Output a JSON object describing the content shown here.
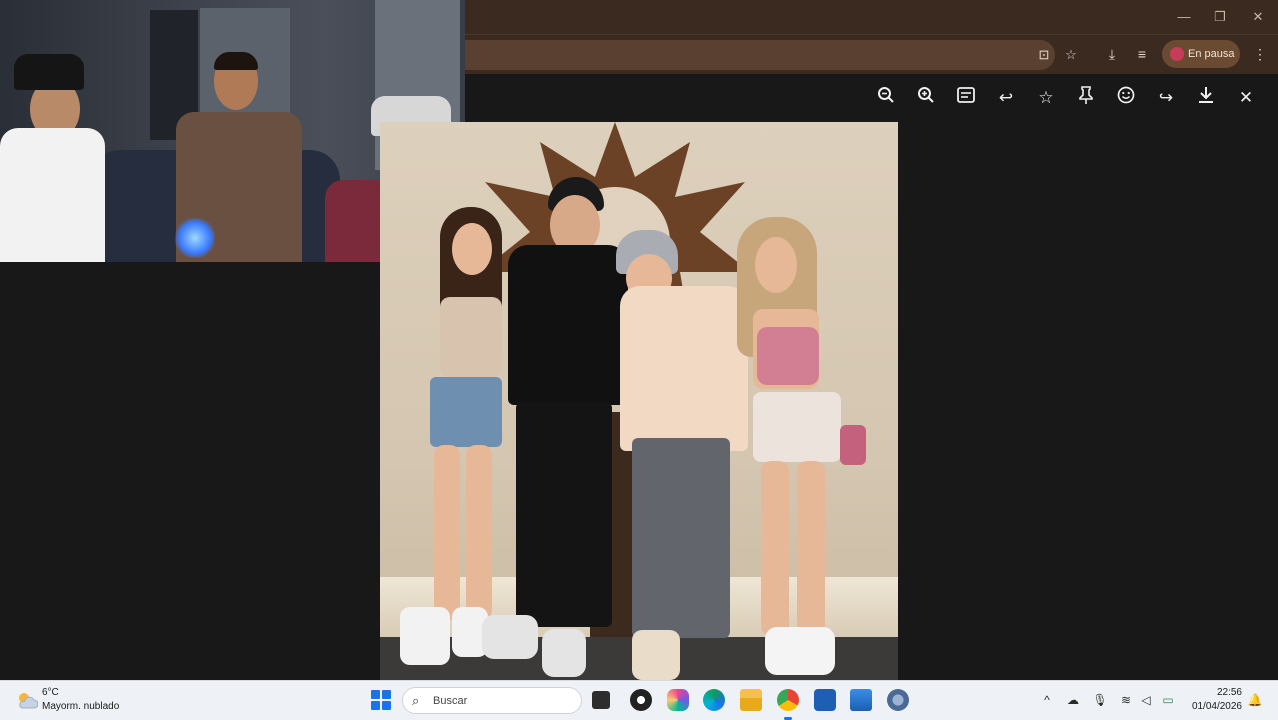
{
  "browser": {
    "window_controls": {
      "minimize": "—",
      "restore": "❐",
      "close": "✕"
    },
    "profile_status": "En pausa"
  },
  "viewer_toolbar": {
    "icons": [
      "zoom-out-icon",
      "zoom-in-icon",
      "caption-icon",
      "reply-icon",
      "star-icon",
      "pin-icon",
      "emoji-icon",
      "forward-icon",
      "download-icon",
      "close-icon"
    ]
  },
  "taskbar": {
    "weather": {
      "temp": "6°C",
      "desc": "Mayorm. nublado"
    },
    "search_placeholder": "Buscar",
    "clock": {
      "time": "22:56",
      "date": "01/04/2026"
    }
  },
  "colors": {
    "browser_frame": "#3a2a1f",
    "viewer_bg": "#181818",
    "taskbar_bg": "#eef1f6",
    "accent": "#1a73e8"
  }
}
